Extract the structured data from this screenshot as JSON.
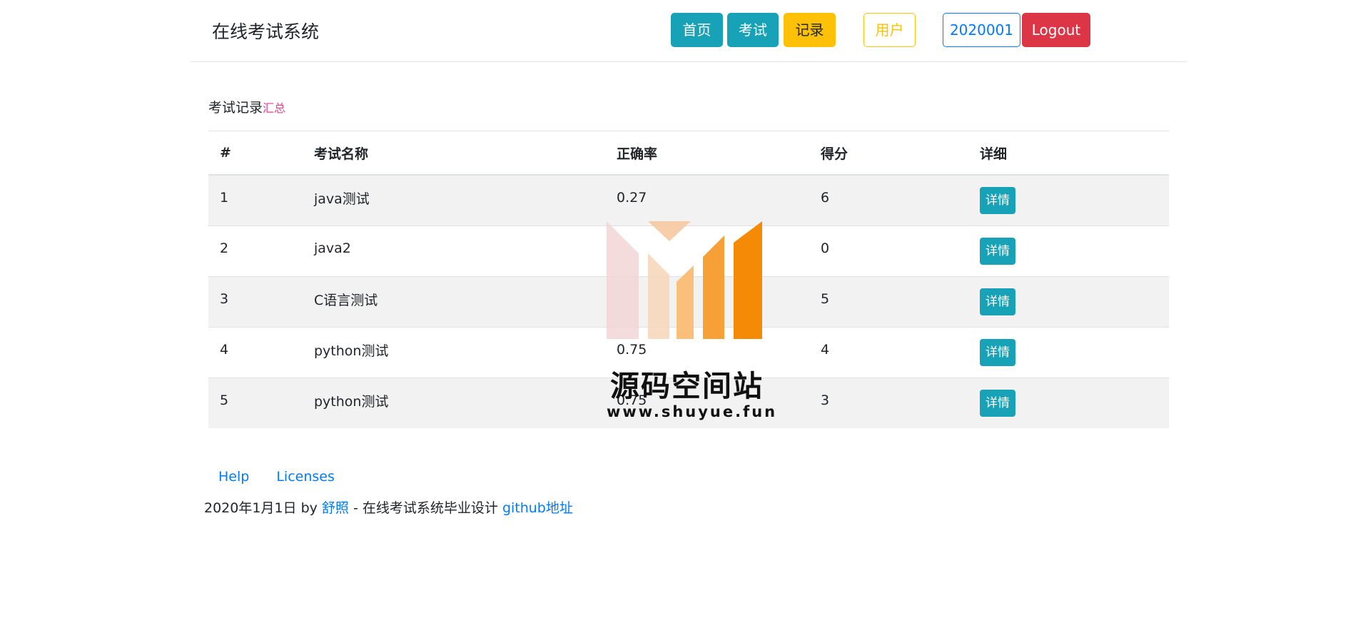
{
  "header": {
    "brand": "在线考试系统",
    "nav": {
      "home": "首页",
      "exam": "考试",
      "records": "记录",
      "users": "用户",
      "account": "2020001",
      "logout": "Logout"
    }
  },
  "main": {
    "heading": "考试记录",
    "heading_link": "汇总",
    "table": {
      "headers": [
        "#",
        "考试名称",
        "正确率",
        "得分",
        "详细"
      ],
      "rows": [
        {
          "no": "1",
          "name": "java测试",
          "accuracy": "0.27",
          "score": "6",
          "action": "详情"
        },
        {
          "no": "2",
          "name": "java2",
          "accuracy": "",
          "score": "0",
          "action": "详情"
        },
        {
          "no": "3",
          "name": "C语言测试",
          "accuracy": "",
          "score": "5",
          "action": "详情"
        },
        {
          "no": "4",
          "name": "python测试",
          "accuracy": "0.75",
          "score": "4",
          "action": "详情"
        },
        {
          "no": "5",
          "name": "python测试",
          "accuracy": "0.75",
          "score": "3",
          "action": "详情"
        }
      ]
    }
  },
  "footer": {
    "links": [
      "Help",
      "Licenses"
    ],
    "date": "2020年1月1日 by",
    "author": "舒照",
    "desc": "- 在线考试系统毕业设计",
    "repo": "github地址"
  },
  "watermark": {
    "title": "源码空间站",
    "url": "www.shuyue.fun"
  },
  "colors": {
    "info": "#17a2b8",
    "warning": "#ffc107",
    "danger": "#dc3545",
    "primary": "#007bff",
    "pink": "#e83e8c"
  }
}
